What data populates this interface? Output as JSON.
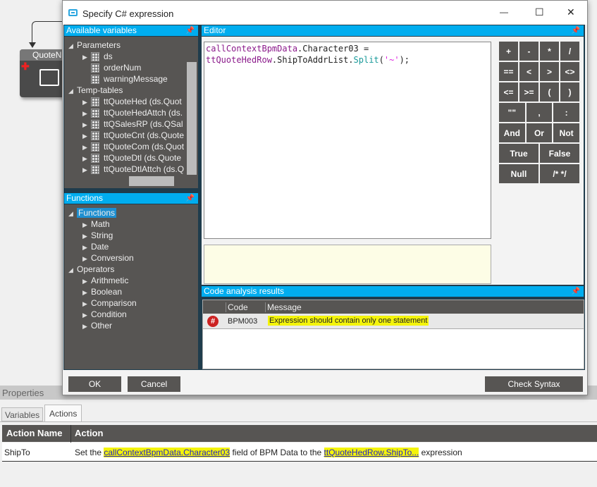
{
  "workflow": {
    "node_title": "QuoteNum"
  },
  "dialog": {
    "title": "Specify C# expression",
    "minimize": "—",
    "maximize": "☐",
    "close": "✕"
  },
  "variables": {
    "header": "Available variables",
    "groups": [
      {
        "label": "Parameters",
        "items": [
          "ds",
          "orderNum",
          "warningMessage"
        ]
      },
      {
        "label": "Temp-tables",
        "items": [
          "ttQuoteHed (ds.Quot",
          "ttQuoteHedAttch (ds.",
          "ttQSalesRP (ds.QSal",
          "ttQuoteCnt (ds.Quote",
          "ttQuoteCom (ds.Quot",
          "ttQuoteDtl (ds.Quote",
          "ttQuoteDtlAttch (ds.Q"
        ]
      }
    ]
  },
  "functions": {
    "header": "Functions",
    "root": "Functions",
    "items": [
      "Math",
      "String",
      "Date",
      "Conversion"
    ],
    "operators": "Operators",
    "op_items": [
      "Arithmetic",
      "Boolean",
      "Comparison",
      "Condition",
      "Other"
    ]
  },
  "editor": {
    "header": "Editor",
    "line1a": "callContextBpmData",
    "line1b": ".Character03  =",
    "line2a": "ttQuoteHedRow",
    "line2b": ".ShipToAddrList.",
    "line2c": "Split",
    "line2d": "(",
    "line2e": "'~'",
    "line2f": ");"
  },
  "keypad": [
    [
      "+",
      "-",
      "*",
      "/"
    ],
    [
      "==",
      "<",
      ">",
      "<>"
    ],
    [
      "<=",
      ">=",
      "(",
      ")"
    ],
    [
      "\"\"",
      ",",
      ":"
    ],
    [
      "And",
      "Or",
      "Not"
    ],
    [
      "True",
      "False"
    ],
    [
      "Null",
      "/* */"
    ]
  ],
  "analysis": {
    "header": "Code analysis results",
    "columns": [
      "Code",
      "Message"
    ],
    "rows": [
      {
        "icon": "#",
        "code": "BPM003",
        "message": "Expression should contain only one statement"
      }
    ]
  },
  "buttons": {
    "ok": "OK",
    "cancel": "Cancel",
    "check": "Check Syntax"
  },
  "properties": {
    "title": "Properties",
    "tabs": [
      "Variables",
      "Actions"
    ],
    "columns": [
      "Action Name",
      "Action"
    ],
    "row": {
      "name": "ShipTo",
      "pre": "Set the ",
      "link1": "callContextBpmData.Character03",
      "mid": " field of BPM Data to the ",
      "link2": "ttQuoteHedRow.ShipTo...",
      "post": " expression"
    }
  }
}
